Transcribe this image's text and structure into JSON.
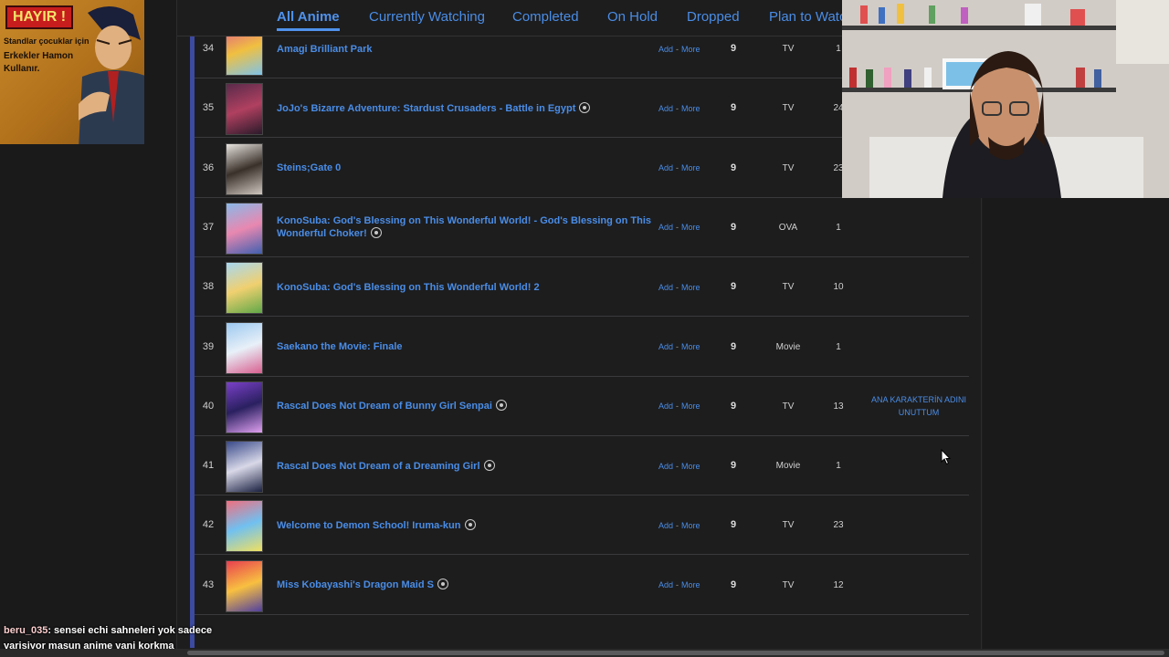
{
  "tabs": [
    {
      "label": "All Anime",
      "active": true
    },
    {
      "label": "Currently Watching"
    },
    {
      "label": "Completed"
    },
    {
      "label": "On Hold"
    },
    {
      "label": "Dropped"
    },
    {
      "label": "Plan to Watch"
    }
  ],
  "sticker": {
    "badge": "HAYIR !",
    "line1": "Standlar çocuklar için",
    "line2": "Erkekler Hamon",
    "line3": "Kullanır."
  },
  "actions": {
    "add": "Add",
    "sep": "-",
    "more": "More"
  },
  "rows": [
    {
      "num": "34",
      "title": "Amagi Brilliant Park",
      "airing": false,
      "score": "9",
      "type": "TV",
      "eps": "1",
      "note": "",
      "thumb": [
        "#e05a8a",
        "#f0c040",
        "#7fc3e8"
      ]
    },
    {
      "num": "35",
      "title": "JoJo's Bizarre Adventure: Stardust Crusaders - Battle in Egypt",
      "airing": true,
      "score": "9",
      "type": "TV",
      "eps": "24",
      "note": "",
      "thumb": [
        "#5a2a4a",
        "#b04060",
        "#2a1a2a"
      ]
    },
    {
      "num": "36",
      "title": "Steins;Gate 0",
      "airing": false,
      "score": "9",
      "type": "TV",
      "eps": "23",
      "note": "",
      "thumb": [
        "#e8e4de",
        "#3a302a",
        "#d0c8c0"
      ]
    },
    {
      "num": "37",
      "title": "KonoSuba: God's Blessing on This Wonderful World! - God's Blessing on This Wonderful Choker!",
      "airing": true,
      "score": "9",
      "type": "OVA",
      "eps": "1",
      "note": "",
      "thumb": [
        "#8ab8e8",
        "#e888b0",
        "#4060b0"
      ]
    },
    {
      "num": "38",
      "title": "KonoSuba: God's Blessing on This Wonderful World! 2",
      "airing": false,
      "score": "9",
      "type": "TV",
      "eps": "10",
      "note": "",
      "thumb": [
        "#a8d8f0",
        "#f0d070",
        "#60a848"
      ]
    },
    {
      "num": "39",
      "title": "Saekano the Movie: Finale",
      "airing": false,
      "score": "9",
      "type": "Movie",
      "eps": "1",
      "note": "",
      "thumb": [
        "#9cc8f0",
        "#e8f0f8",
        "#d86090"
      ]
    },
    {
      "num": "40",
      "title": "Rascal Does Not Dream of Bunny Girl Senpai",
      "airing": true,
      "score": "9",
      "type": "TV",
      "eps": "13",
      "note": "ANA KARAKTERİN ADINI UNUTTUM",
      "thumb": [
        "#7a40c8",
        "#2a2060",
        "#e0a0f0"
      ]
    },
    {
      "num": "41",
      "title": "Rascal Does Not Dream of a Dreaming Girl",
      "airing": true,
      "score": "9",
      "type": "Movie",
      "eps": "1",
      "note": "",
      "thumb": [
        "#3a4a8a",
        "#d8d8e8",
        "#1a2040"
      ]
    },
    {
      "num": "42",
      "title": "Welcome to Demon School! Iruma-kun",
      "airing": true,
      "score": "9",
      "type": "TV",
      "eps": "23",
      "note": "",
      "thumb": [
        "#f07080",
        "#70c0f0",
        "#f0e060"
      ]
    },
    {
      "num": "43",
      "title": "Miss Kobayashi's Dragon Maid S",
      "airing": true,
      "score": "9",
      "type": "TV",
      "eps": "12",
      "note": "",
      "thumb": [
        "#e84050",
        "#f8c040",
        "#5040a0"
      ]
    }
  ],
  "chat": {
    "user": "beru_035",
    "message": ": sensei echi sahneleri yok sadece yarisiyor masun anime yani korkma"
  }
}
